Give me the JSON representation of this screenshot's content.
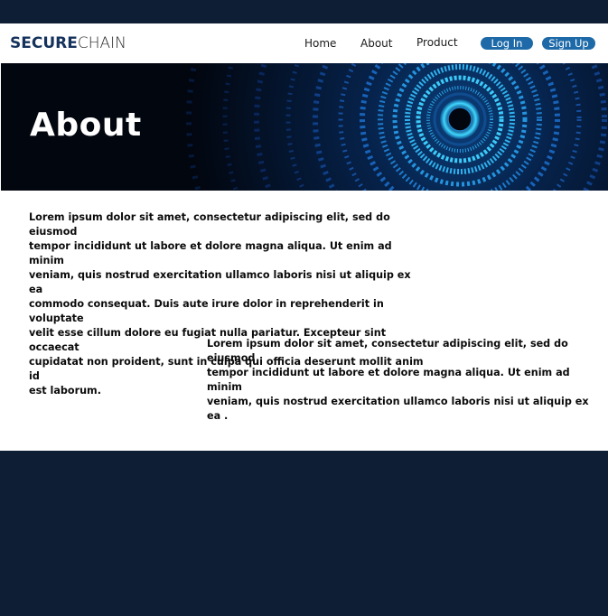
{
  "brand": {
    "name_bold": "SECURE",
    "name_light": "CHAIN"
  },
  "nav": {
    "links": [
      "Home",
      "About",
      "Product"
    ],
    "login_label": "Log In",
    "signup_label": "Sign Up"
  },
  "hero": {
    "title": "About"
  },
  "content": {
    "paragraph_1": "Lorem ipsum dolor sit amet, consectetur adipiscing elit, sed do eiusmod\n tempor incididunt ut labore et dolore magna aliqua. Ut enim ad minim\nveniam, quis nostrud exercitation ullamco laboris nisi ut aliquip ex ea\ncommodo consequat. Duis aute irure dolor in reprehenderit in voluptate\nvelit esse cillum dolore eu fugiat nulla pariatur. Excepteur sint occaecat\n cupidatat non proident, sunt in culpa qui officia deserunt mollit anim id\nest laborum.",
    "paragraph_2": "Lorem ipsum dolor sit amet, consectetur adipiscing elit, sed do eiusmod\n tempor incididunt ut labore et dolore magna aliqua. Ut enim ad minim\n veniam, quis nostrud exercitation ullamco laboris nisi ut aliquip ex ea ."
  },
  "colors": {
    "dark_navy": "#0d1e35",
    "pill_blue": "#1e6aa8",
    "brand_blue": "#15325c"
  }
}
